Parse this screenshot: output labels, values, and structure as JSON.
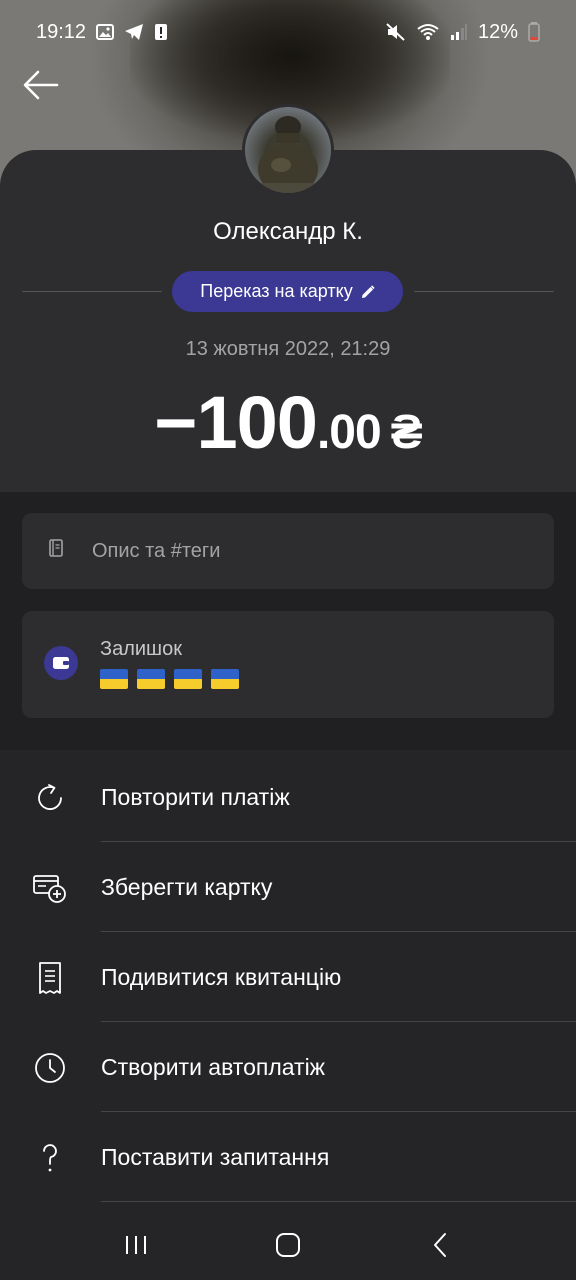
{
  "status_bar": {
    "time": "19:12",
    "battery": "12%"
  },
  "header": {
    "back_icon": "arrow-left-icon"
  },
  "contact": {
    "name": "Олександр К."
  },
  "transfer": {
    "type_label": "Переказ на картку",
    "edit_icon": "pencil-icon",
    "datetime": "13 жовтня 2022, 21:29",
    "amount_sign": "−",
    "amount_int": "100",
    "amount_dec": ".00",
    "currency": "₴"
  },
  "description": {
    "placeholder": "Опис та #теги",
    "icon": "notebook-icon"
  },
  "balance": {
    "label": "Залишок",
    "icon": "wallet-icon",
    "masked_flags": 4
  },
  "menu": {
    "items": [
      {
        "label": "Повторити платіж",
        "icon": "repeat-icon"
      },
      {
        "label": "Зберегти картку",
        "icon": "card-add-icon"
      },
      {
        "label": "Подивитися квитанцію",
        "icon": "receipt-icon"
      },
      {
        "label": "Створити автоплатіж",
        "icon": "clock-icon"
      },
      {
        "label": "Поставити запитання",
        "icon": "question-icon"
      }
    ]
  },
  "colors": {
    "accent": "#3b3994",
    "background": "#252528",
    "card": "#2d2d30",
    "muted_text": "#a3a3a6"
  }
}
